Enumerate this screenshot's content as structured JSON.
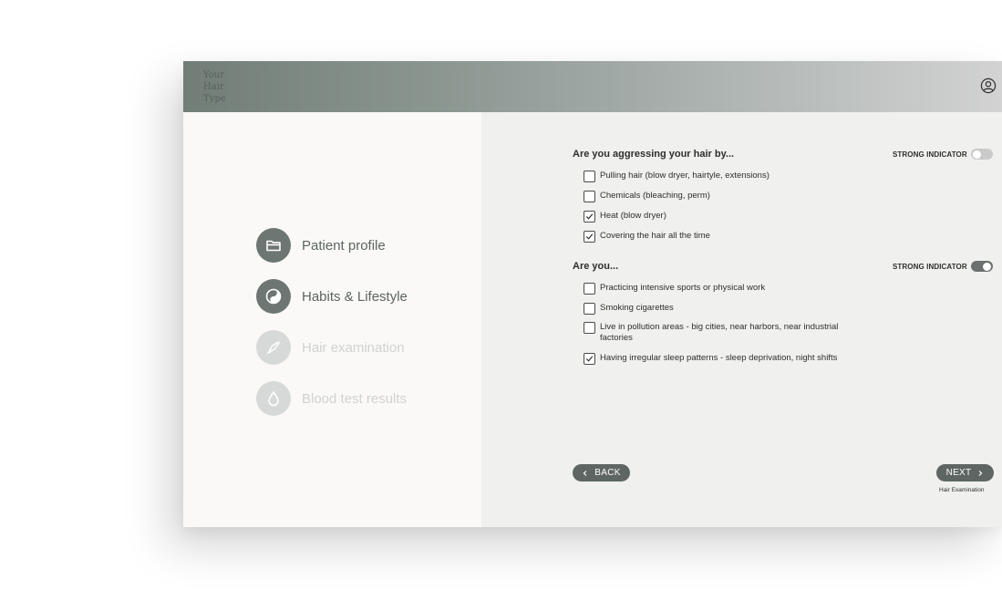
{
  "app": {
    "logo_lines": [
      "Your",
      "Hair",
      "Type"
    ],
    "profile_icon": "user-circle-icon"
  },
  "steps": [
    {
      "label": "Patient profile",
      "icon": "folder-icon",
      "state": "active"
    },
    {
      "label": "Habits & Lifestyle",
      "icon": "yin-yang-icon",
      "state": "active"
    },
    {
      "label": "Hair examination",
      "icon": "brush-icon",
      "state": "inactive"
    },
    {
      "label": "Blood test results",
      "icon": "drop-icon",
      "state": "inactive"
    }
  ],
  "questions": [
    {
      "title": "Are you aggressing your hair by...",
      "indicator_label": "STRONG INDICATOR",
      "indicator_on": false,
      "options": [
        {
          "label": "Pulling hair (blow dryer, hairtyle, extensions)",
          "checked": false
        },
        {
          "label": "Chemicals (bleaching, perm)",
          "checked": false
        },
        {
          "label": "Heat (blow dryer)",
          "checked": true
        },
        {
          "label": "Covering the hair all the time",
          "checked": true
        }
      ]
    },
    {
      "title": "Are you...",
      "indicator_label": "STRONG INDICATOR",
      "indicator_on": true,
      "options": [
        {
          "label": "Practicing intensive sports or physical work",
          "checked": false
        },
        {
          "label": "Smoking cigarettes",
          "checked": false
        },
        {
          "label": "Live in pollution areas - big cities, near harbors, near industrial factories",
          "checked": false
        },
        {
          "label": "Having irregular sleep patterns - sleep deprivation, night shifts",
          "checked": true
        }
      ]
    }
  ],
  "nav": {
    "back_label": "BACK",
    "back_icon": "chevron-left-icon",
    "next_label": "NEXT",
    "next_icon": "chevron-right-icon",
    "next_sublabel": "Hair Examination"
  }
}
